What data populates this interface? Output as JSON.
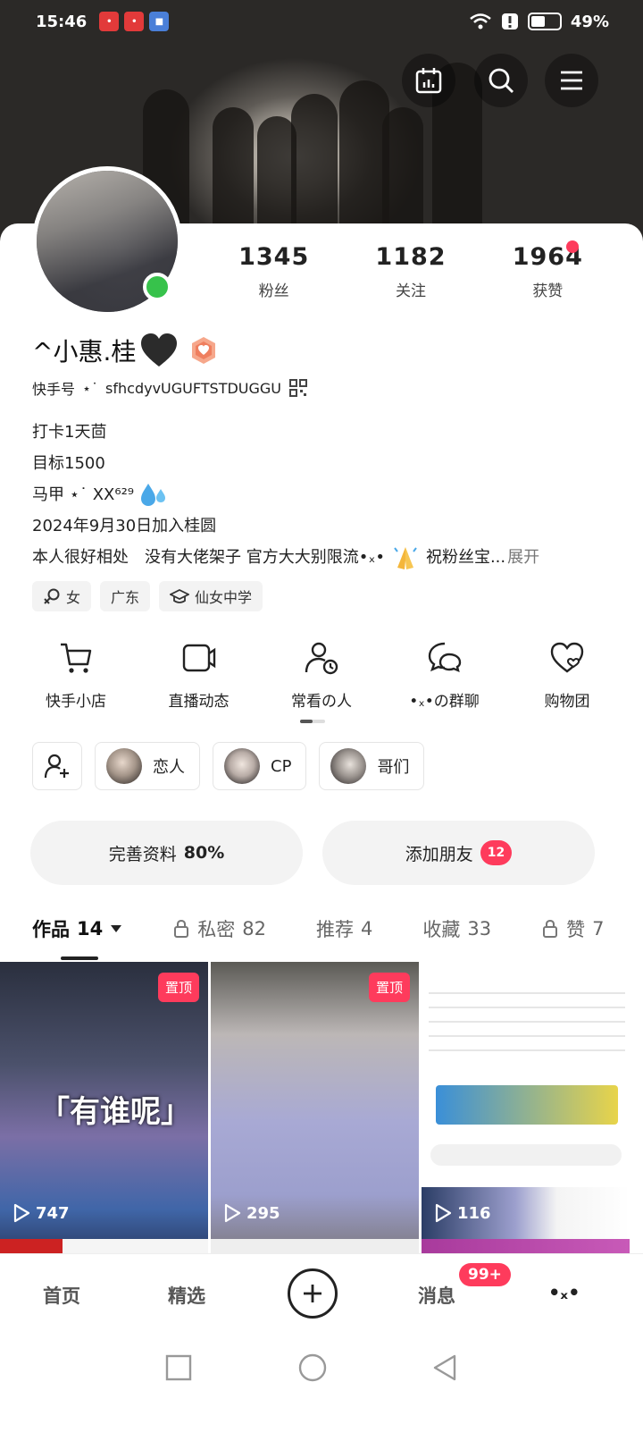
{
  "status_bar": {
    "time": "15:46",
    "battery": "49%",
    "battery_level": 0.49
  },
  "header": {
    "calendar_icon": "calendar-icon",
    "search_icon": "search-icon",
    "menu_icon": "menu-icon"
  },
  "profile": {
    "name": "^小惠.桂",
    "kuaishou_id_label": "快手号",
    "kuaishou_id": "sfhcdyvUGUFTSTDUGGU",
    "stats": [
      {
        "value": "1345",
        "label": "粉丝"
      },
      {
        "value": "1182",
        "label": "关注"
      },
      {
        "value": "1964",
        "label": "获赞"
      }
    ],
    "bio": [
      "打卡1天茴",
      "目标1500",
      "马甲 ⋆˙ XX⁶²⁹",
      "2024年9月30日加入桂圆",
      "本人很好相处　没有大佬架子 官方大大别限流•ₓ•",
      "祝粉丝宝..."
    ],
    "expand_label": "展开",
    "tags": [
      "女",
      "广东",
      "仙女中学"
    ]
  },
  "features": [
    {
      "label": "快手小店",
      "icon": "cart-icon"
    },
    {
      "label": "直播动态",
      "icon": "video-icon"
    },
    {
      "label": "常看の人",
      "icon": "user-clock-icon"
    },
    {
      "label": "•ₓ•の群聊",
      "icon": "chat-icon"
    },
    {
      "label": "购物团",
      "icon": "heart-icon"
    }
  ],
  "groups": [
    "恋人",
    "CP",
    "哥们"
  ],
  "actions": {
    "complete_profile": "完善资料",
    "complete_percent": "80%",
    "add_friends": "添加朋友",
    "add_friends_badge": "12"
  },
  "tabs": [
    {
      "label": "作品",
      "count": "14",
      "active": true
    },
    {
      "label": "私密",
      "count": "82",
      "locked": true
    },
    {
      "label": "推荐",
      "count": "4"
    },
    {
      "label": "收藏",
      "count": "33"
    },
    {
      "label": "赞",
      "count": "7",
      "locked": true
    }
  ],
  "grid": [
    {
      "pinned_label": "置顶",
      "plays": "747",
      "overlay": "「有谁呢」"
    },
    {
      "pinned_label": "置顶",
      "plays": "295"
    },
    {
      "plays": "116"
    }
  ],
  "bottom_nav": {
    "home": "首页",
    "featured": "精选",
    "messages": "消息",
    "messages_badge": "99+",
    "more": "•ₓ•"
  },
  "colors": {
    "accent": "#fe3b5c",
    "online": "#37c24b"
  }
}
